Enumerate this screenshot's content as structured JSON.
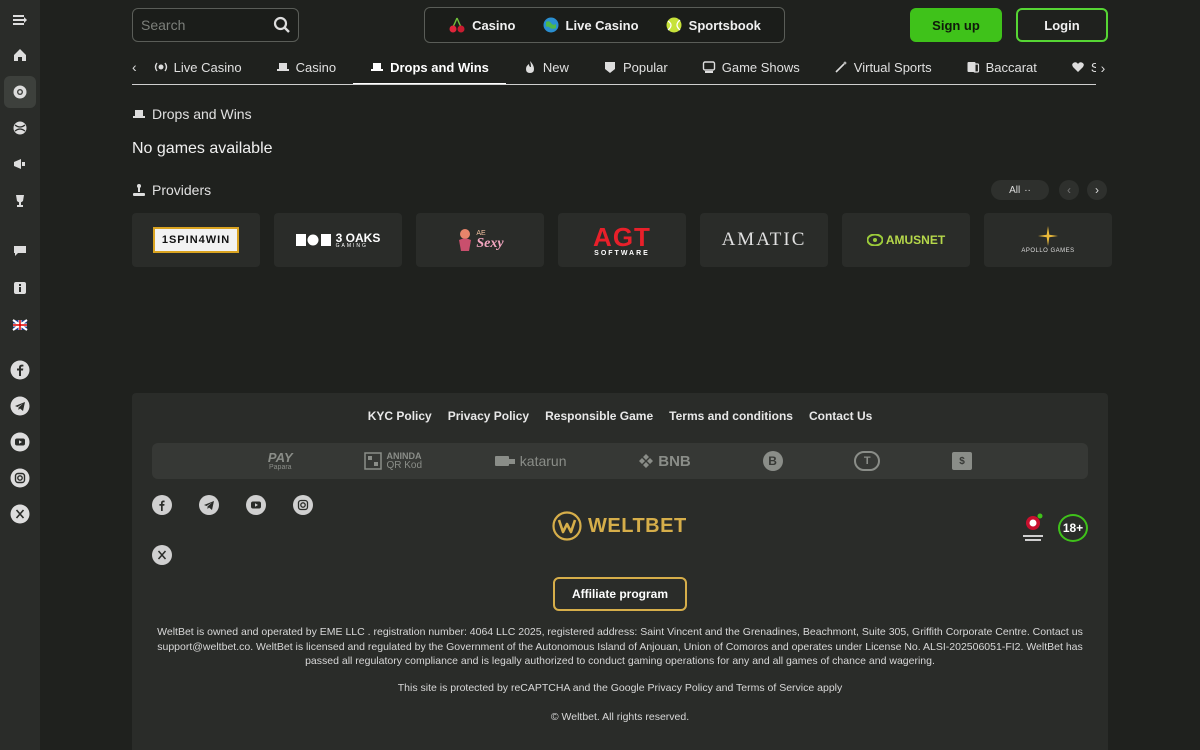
{
  "sidebar": {
    "items": [
      {
        "icon": "menu-icon"
      },
      {
        "icon": "home-icon"
      },
      {
        "icon": "casino-chip-icon",
        "active": true
      },
      {
        "icon": "sports-ball-icon"
      },
      {
        "icon": "megaphone-icon"
      },
      {
        "icon": "trophy-icon"
      },
      {
        "icon": "chat-icon"
      },
      {
        "icon": "info-icon"
      },
      {
        "icon": "uk-flag-icon"
      },
      {
        "icon": "facebook-icon"
      },
      {
        "icon": "telegram-icon"
      },
      {
        "icon": "youtube-icon"
      },
      {
        "icon": "instagram-icon"
      },
      {
        "icon": "x-icon"
      }
    ]
  },
  "header": {
    "search_placeholder": "Search",
    "modes": [
      {
        "label": "Casino",
        "icon": "cherry-icon"
      },
      {
        "label": "Live Casino",
        "icon": "globe-icon"
      },
      {
        "label": "Sportsbook",
        "icon": "tennis-ball-icon"
      }
    ],
    "signup_label": "Sign up",
    "login_label": "Login"
  },
  "tabs": [
    {
      "label": "Live Casino",
      "icon": "live-icon"
    },
    {
      "label": "Casino",
      "icon": "hat-icon"
    },
    {
      "label": "Drops and Wins",
      "icon": "hat-icon",
      "active": true
    },
    {
      "label": "New",
      "icon": "flame-icon"
    },
    {
      "label": "Popular",
      "icon": "badge-icon"
    },
    {
      "label": "Game Shows",
      "icon": "tv-icon"
    },
    {
      "label": "Virtual Sports",
      "icon": "wand-icon"
    },
    {
      "label": "Baccarat",
      "icon": "cards-icon"
    },
    {
      "label": "Slot",
      "icon": "heart-icon"
    }
  ],
  "section": {
    "title": "Drops and Wins",
    "empty_message": "No games available"
  },
  "providers": {
    "title": "Providers",
    "filter_label": "All",
    "items": [
      {
        "name": "1SPIN4WIN"
      },
      {
        "name": "3 OAKS",
        "sub": "GAMING"
      },
      {
        "name": "Sexy",
        "prefix": "AE"
      },
      {
        "name": "AGT",
        "sub": "SOFTWARE"
      },
      {
        "name": "AMATIC"
      },
      {
        "name": "AMUSNET"
      },
      {
        "name": "APOLLO GAMES"
      }
    ]
  },
  "footer": {
    "links": [
      "KYC Policy",
      "Privacy Policy",
      "Responsible Game",
      "Terms and conditions",
      "Contact Us"
    ],
    "payments": [
      {
        "label": "PAY",
        "sub": "Papara"
      },
      {
        "label": "ANINDA",
        "sub": "QR Kod"
      },
      {
        "label": "katarun"
      },
      {
        "label": "BNB"
      },
      {
        "label": "B"
      },
      {
        "label": "T"
      },
      {
        "label": "$"
      }
    ],
    "logo_text": "WELTBET",
    "age_label": "18+",
    "affiliate_label": "Affiliate program",
    "legal_text": "WeltBet is owned and operated by EME LLC . registration number: 4064 LLC 2025, registered address: Saint Vincent and the Grenadines, Beachmont, Suite 305, Griffith Corporate Centre. Contact us support@weltbet.co. WeltBet is licensed and regulated by the Government of the Autonomous Island of Anjouan, Union of Comoros and operates under License No. ALSI-202506051-FI2. WeltBet has passed all regulatory compliance and is legally authorized to conduct gaming operations for any and all games of chance and wagering.",
    "captcha_text": "This site is protected by reCAPTCHA and the Google Privacy Policy and Terms of Service apply",
    "copyright": "© Weltbet. All rights reserved."
  },
  "colors": {
    "accent_green": "#3fc21a",
    "gold": "#d6ae4a",
    "background": "#1f211e"
  }
}
